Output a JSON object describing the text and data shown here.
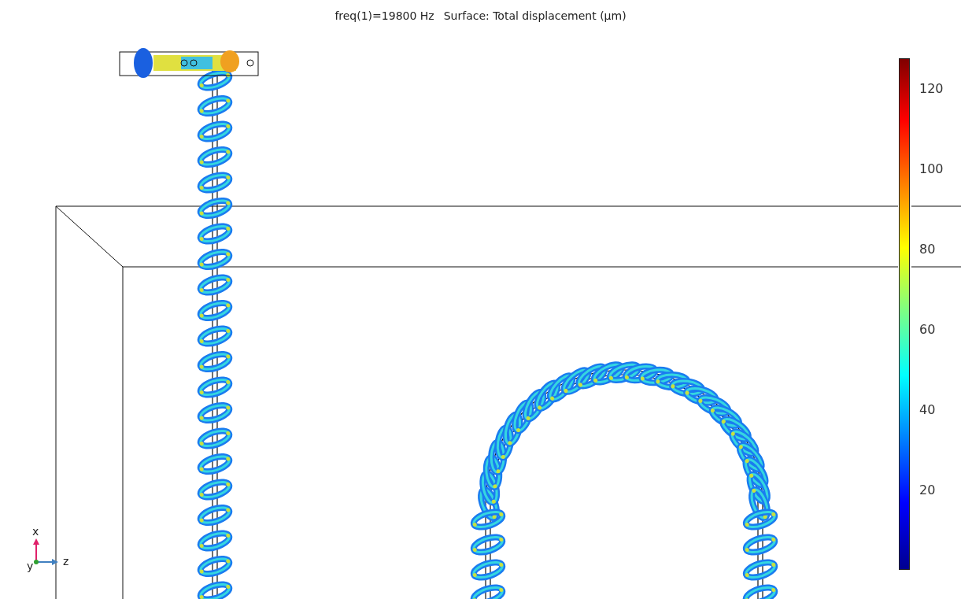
{
  "plot_title": {
    "frequency": "freq(1)=19800 Hz",
    "expression": "Surface: Total displacement (µm)"
  },
  "color_legend": {
    "ticks": [
      "120",
      "100",
      "80",
      "60",
      "40",
      "20"
    ]
  },
  "axes": {
    "x": "x",
    "y": "y",
    "z": "z"
  }
}
